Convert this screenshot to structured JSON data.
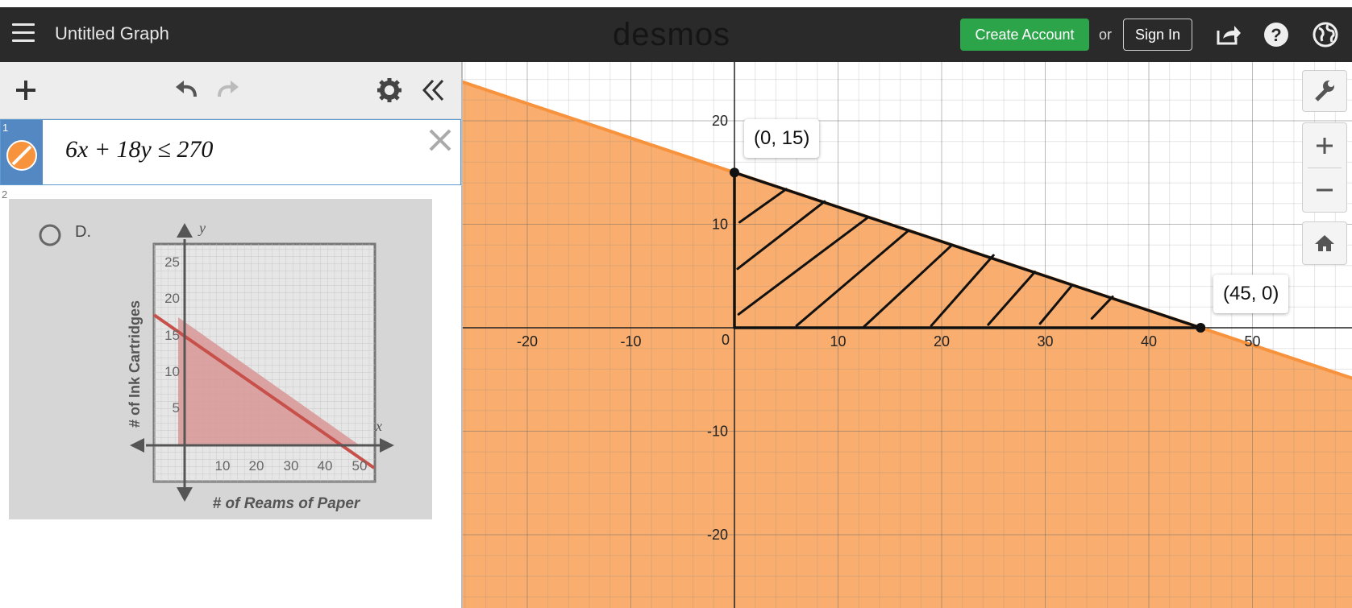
{
  "header": {
    "title": "Untitled Graph",
    "logo": "desmos",
    "create_account": "Create Account",
    "or": "or",
    "sign_in": "Sign In",
    "bg_color": "#2a2a2a",
    "create_color": "#2ca54a",
    "icons": [
      "menu-icon",
      "share-icon",
      "help-icon",
      "globe-icon"
    ]
  },
  "toolbar": {
    "icons": [
      "add-icon",
      "undo-icon",
      "redo-icon",
      "settings-icon",
      "collapse-icon"
    ]
  },
  "expressions": [
    {
      "number": "1",
      "latex": "6x + 18y ≤ 270",
      "color": "#f7923d"
    },
    {
      "number": "2",
      "type": "image"
    }
  ],
  "image": {
    "option": "D.",
    "y_axis_label": "# of Ink Cartridges",
    "x_axis_label": "# of Reams of Paper",
    "x_letter": "x",
    "y_letter": "y",
    "y_ticks": [
      "25",
      "20",
      "15",
      "10",
      "5"
    ],
    "x_ticks": [
      "10",
      "20",
      "30",
      "40",
      "50"
    ]
  },
  "graph": {
    "x_range": [
      -26,
      59
    ],
    "y_range": [
      -27,
      26
    ],
    "x_tick_labels": [
      "-20",
      "-10",
      "0",
      "10",
      "20",
      "30",
      "40",
      "50"
    ],
    "y_tick_labels": [
      "20",
      "10",
      "-10",
      "-20"
    ],
    "fill_color": "#f7923d",
    "points": [
      {
        "label": "(0, 15)",
        "x": 0,
        "y": 15
      },
      {
        "label": "(45, 0)",
        "x": 45,
        "y": 0
      }
    ],
    "controls": [
      "wrench-icon",
      "zoom-in-icon",
      "zoom-out-icon",
      "home-icon"
    ]
  }
}
